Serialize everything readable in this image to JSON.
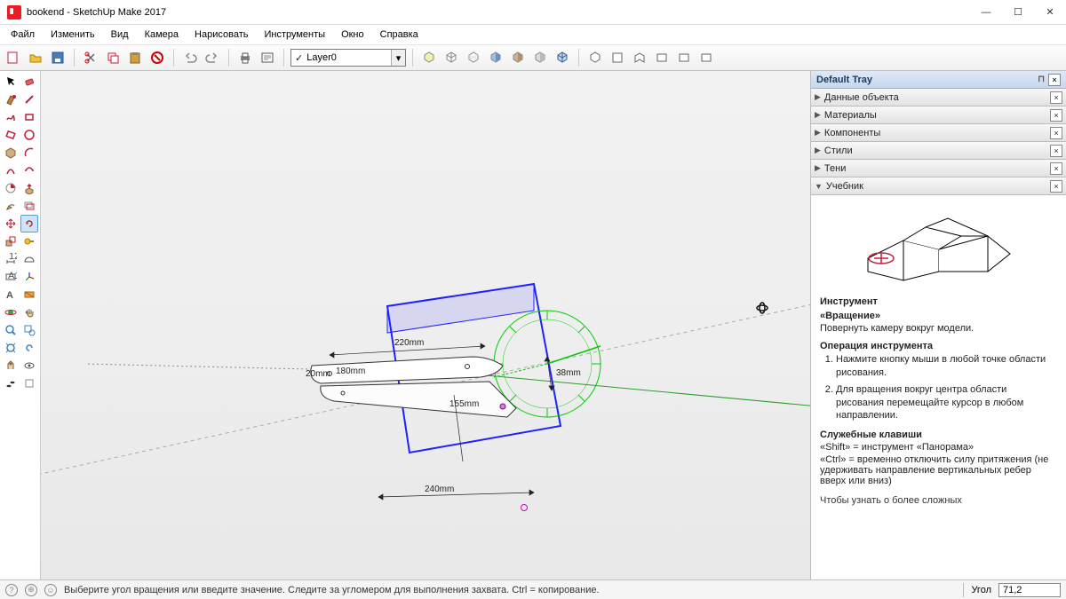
{
  "window": {
    "title": "bookend - SketchUp Make 2017"
  },
  "menu": {
    "items": [
      "Файл",
      "Изменить",
      "Вид",
      "Камера",
      "Нарисовать",
      "Инструменты",
      "Окно",
      "Справка"
    ]
  },
  "layer": {
    "label": "Layer0"
  },
  "tray": {
    "title": "Default Tray",
    "panels": [
      {
        "label": "Данные объекта"
      },
      {
        "label": "Материалы"
      },
      {
        "label": "Компоненты"
      },
      {
        "label": "Стили"
      },
      {
        "label": "Тени"
      },
      {
        "label": "Учебник",
        "open": true
      }
    ]
  },
  "instructor": {
    "tool_label": "Инструмент",
    "tool_name": "«Вращение»",
    "tool_desc": "Повернуть камеру вокруг модели.",
    "op_heading": "Операция инструмента",
    "steps": [
      "Нажмите кнопку мыши в любой точке области рисования.",
      "Для вращения вокруг центра области рисования перемещайте курсор в любом направлении."
    ],
    "mod_heading": "Служебные клавиши",
    "mod1": "«Shift» = инструмент «Панорама»",
    "mod2": "«Ctrl» = временно отключить силу притяжения (не удерживать направление вертикальных ребер вверх или вниз)",
    "more_cut": "Чтобы узнать о более сложных"
  },
  "dims": {
    "d1": "220mm",
    "d2": "180mm",
    "d3": "20mm",
    "d4": "155mm",
    "d5": "38mm",
    "d6": "240mm"
  },
  "status": {
    "msg": "Выберите угол вращения или введите значение.  Следите за угломером для выполнения захвата. Ctrl = копирование.",
    "angle_label": "Угол",
    "angle_value": "71,2"
  },
  "icons": {
    "min": "—",
    "max": "☐",
    "close": "✕",
    "check": "✓",
    "drop": "▾",
    "pin": "📌"
  }
}
